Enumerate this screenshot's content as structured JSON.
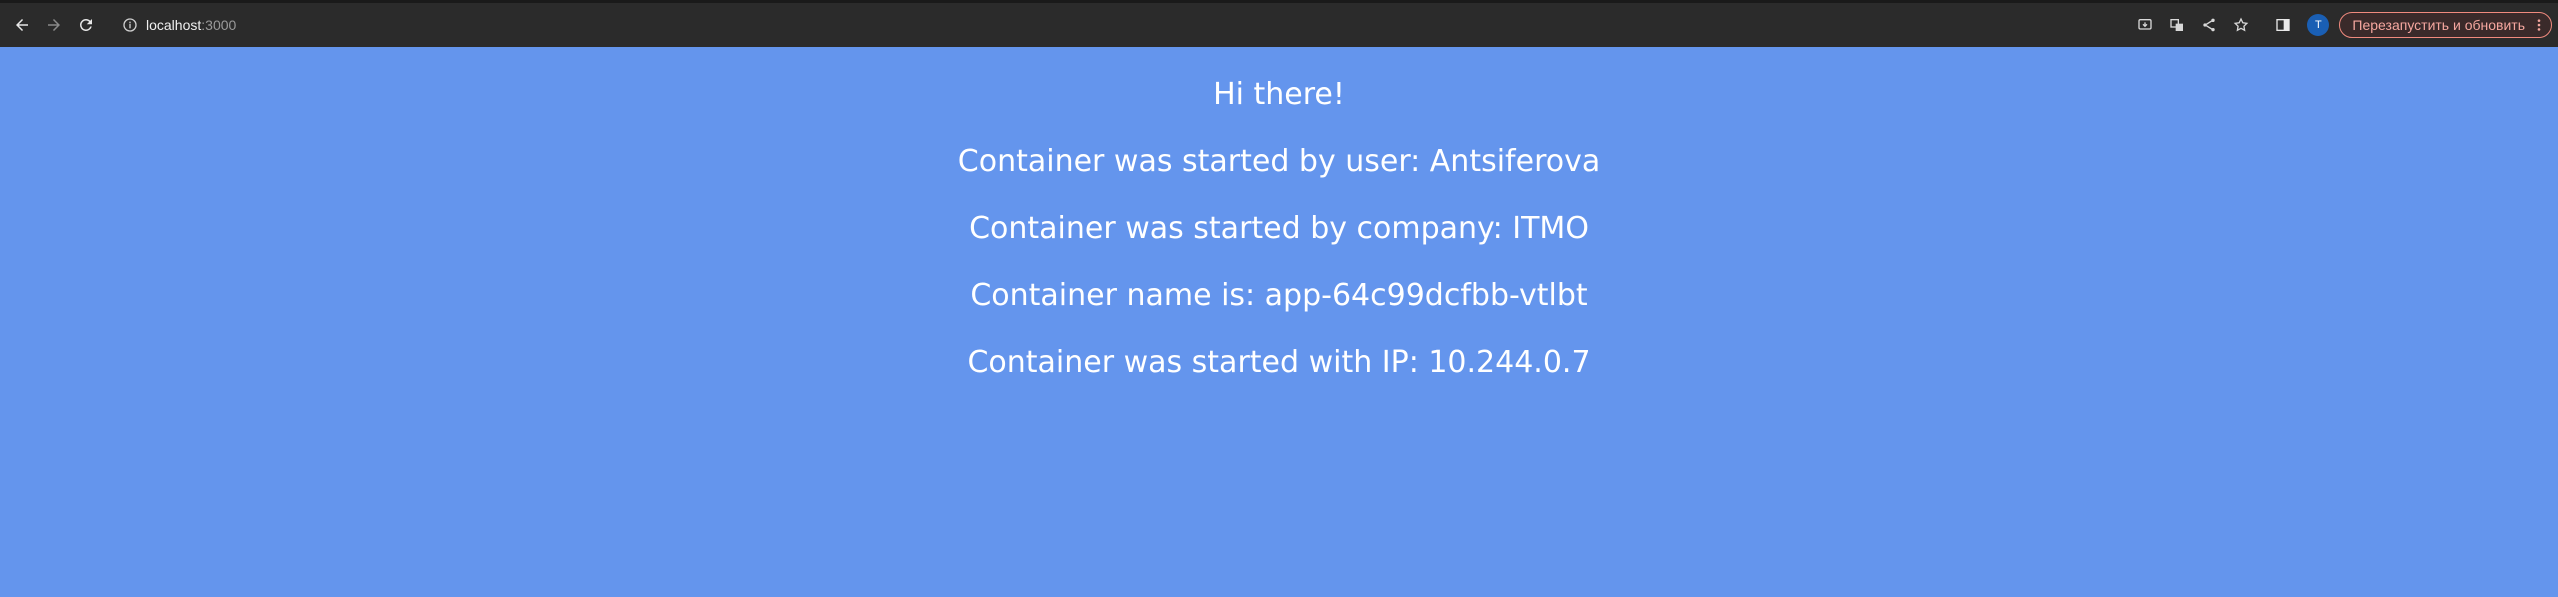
{
  "browser": {
    "url_host": "localhost",
    "url_port": ":3000",
    "profile_initial": "T",
    "update_button_label": "Перезапустить и обновить"
  },
  "page": {
    "greeting": "Hi there!",
    "user_line": "Container was started by user: Antsiferova",
    "company_line": "Container was started by company: ITMO",
    "name_line": "Container name is: app-64c99dcfbb-vtlbt",
    "ip_line": "Container was started with IP: 10.244.0.7"
  },
  "colors": {
    "page_background": "#6495ed",
    "toolbar_background": "#2b2b2b",
    "update_accent": "#f08a7e",
    "avatar_background": "#1a5fb4"
  },
  "icons": [
    "back-icon",
    "forward-icon",
    "reload-icon",
    "info-icon",
    "install-icon",
    "translate-icon",
    "share-icon",
    "bookmark-star-icon",
    "side-panel-icon",
    "more-vert-icon"
  ]
}
